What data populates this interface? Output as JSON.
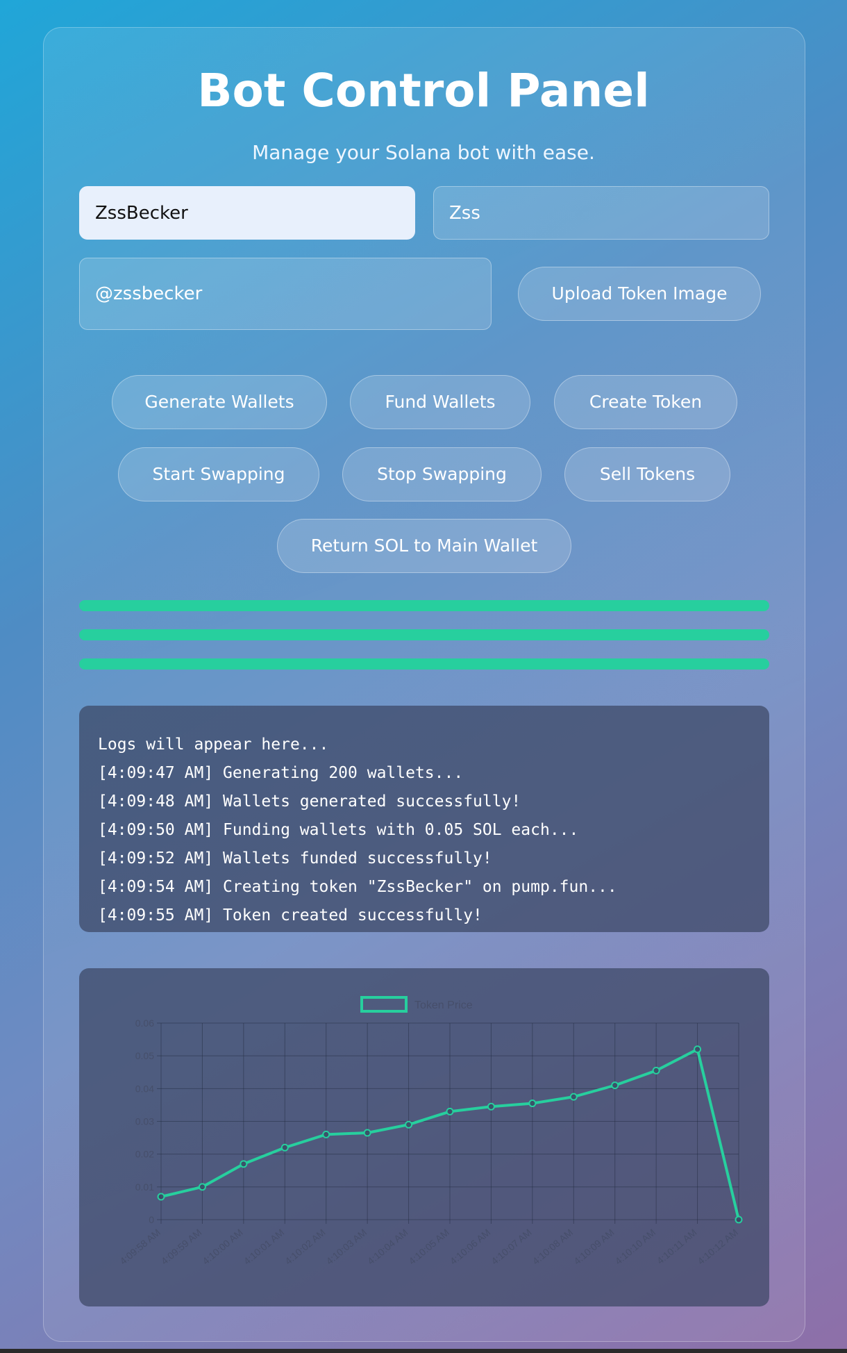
{
  "header": {
    "title": "Bot Control Panel",
    "subtitle": "Manage your Solana bot with ease."
  },
  "form": {
    "token_name": "ZssBecker",
    "token_symbol": "Zss",
    "twitter_handle": "@zssbecker",
    "upload_label": "Upload Token Image"
  },
  "actions": {
    "generate_wallets": "Generate Wallets",
    "fund_wallets": "Fund Wallets",
    "create_token": "Create Token",
    "start_swapping": "Start Swapping",
    "stop_swapping": "Stop Swapping",
    "sell_tokens": "Sell Tokens",
    "return_sol": "Return SOL to Main Wallet"
  },
  "progress": [
    1.0,
    1.0,
    1.0
  ],
  "colors": {
    "accent": "#27cf9e",
    "panel": "#3c4664"
  },
  "logs": [
    "Logs will appear here...",
    "[4:09:47 AM] Generating 200 wallets...",
    "[4:09:48 AM] Wallets generated successfully!",
    "[4:09:50 AM] Funding wallets with 0.05 SOL each...",
    "[4:09:52 AM] Wallets funded successfully!",
    "[4:09:54 AM] Creating token \"ZssBecker\" on pump.fun...",
    "[4:09:55 AM] Token created successfully!"
  ],
  "chart_data": {
    "type": "line",
    "series": [
      {
        "name": "Token Price",
        "values": [
          0.007,
          0.01,
          0.017,
          0.022,
          0.026,
          0.0265,
          0.029,
          0.033,
          0.0345,
          0.0355,
          0.0375,
          0.041,
          0.0455,
          0.052,
          0.0
        ]
      }
    ],
    "categories": [
      "4:09:58 AM",
      "4:09:59 AM",
      "4:10:00 AM",
      "4:10:01 AM",
      "4:10:02 AM",
      "4:10:03 AM",
      "4:10:04 AM",
      "4:10:05 AM",
      "4:10:06 AM",
      "4:10:07 AM",
      "4:10:08 AM",
      "4:10:09 AM",
      "4:10:10 AM",
      "4:10:11 AM",
      "4:10:12 AM"
    ],
    "y_ticks": [
      "0",
      "0.01",
      "0.02",
      "0.03",
      "0.04",
      "0.05",
      "0.06"
    ],
    "ylim": [
      0,
      0.06
    ],
    "grid": true,
    "legend": "top-center"
  }
}
